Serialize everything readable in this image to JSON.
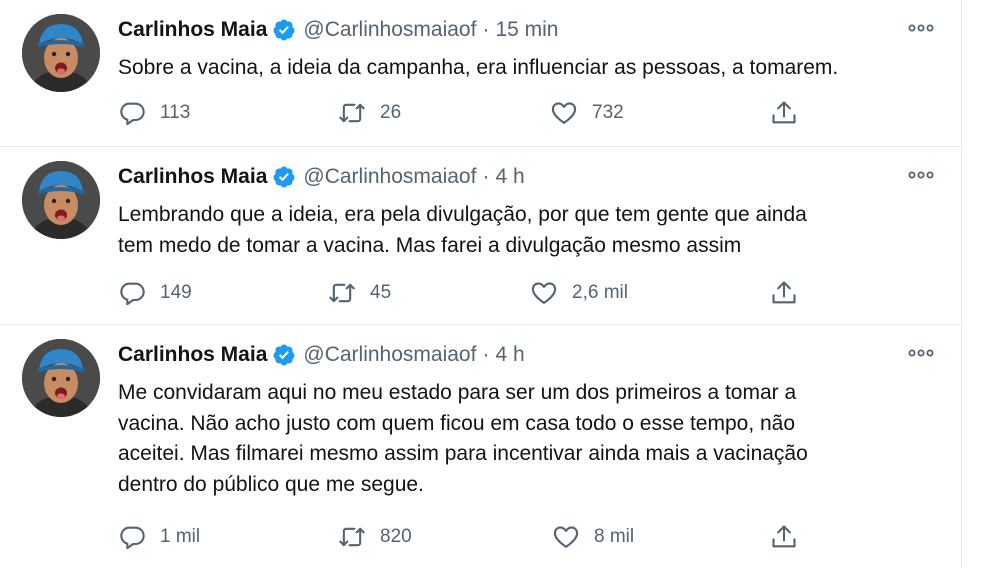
{
  "tweets": [
    {
      "author": "Carlinhos Maia",
      "handle": "@Carlinhosmaiaof",
      "separator": "·",
      "time": "15 min",
      "lines": [
        "Sobre a vacina, a ideia da campanha, era influenciar as pessoas, a tomarem."
      ],
      "replies": "113",
      "retweets": "26",
      "likes": "732"
    },
    {
      "author": "Carlinhos Maia",
      "handle": "@Carlinhosmaiaof",
      "separator": "·",
      "time": "4 h",
      "lines": [
        "Lembrando que a ideia, era pela divulgação, por que tem gente que ainda",
        "tem medo de tomar a vacina. Mas farei a divulgação mesmo assim"
      ],
      "replies": "149",
      "retweets": "45",
      "likes": "2,6 mil"
    },
    {
      "author": "Carlinhos Maia",
      "handle": "@Carlinhosmaiaof",
      "separator": "·",
      "time": "4 h",
      "lines": [
        "Me convidaram aqui no meu estado para ser um dos primeiros a tomar a",
        "vacina. Não acho justo com quem ficou em casa todo o esse tempo, não",
        "aceitei. Mas filmarei mesmo assim para incentivar ainda mais a vacinação",
        "dentro do público que me segue."
      ],
      "replies": "1 mil",
      "retweets": "820",
      "likes": "8 mil"
    }
  ],
  "icons": {
    "reply": "reply-icon",
    "retweet": "retweet-icon",
    "like": "heart-icon",
    "share": "share-icon",
    "more": "more-icon",
    "verified": "verified-badge-icon"
  },
  "colors": {
    "verified": "#1d9bf0",
    "text": "#0f1419",
    "muted": "#536471",
    "divider": "#e6ecf0"
  }
}
